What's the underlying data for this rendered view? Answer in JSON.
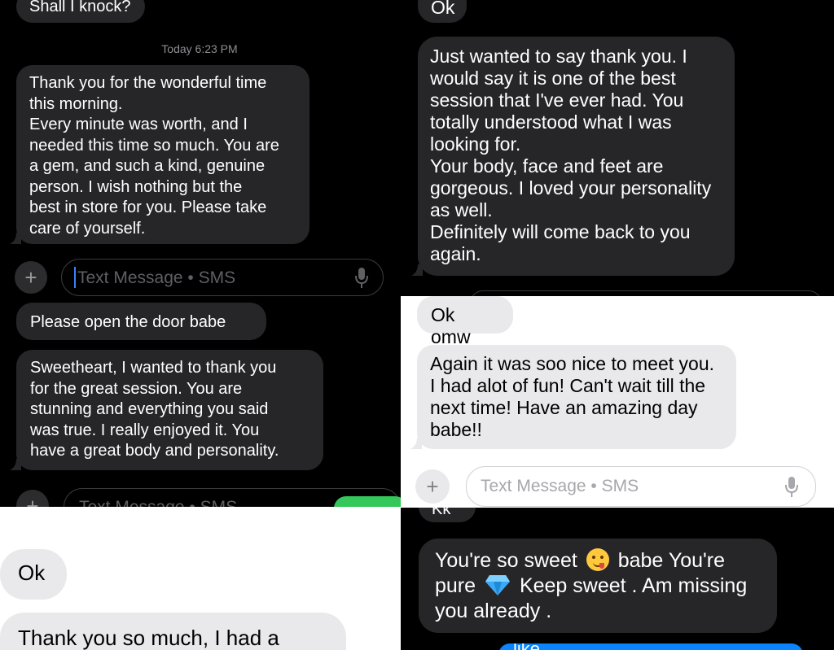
{
  "panel_top_left": {
    "messages": [
      "Shall I knock?",
      "Thank you for the wonderful time\nthis morning.\nEvery minute was worth, and I\nneeded this time so much. You are\na gem, and such a kind, genuine\nperson. I wish nothing but the\nbest in store for you. Please take\ncare of yourself."
    ],
    "timestamp_day": "Today",
    "timestamp_time": "6:23 PM",
    "input_placeholder": "Text Message • SMS"
  },
  "panel_mid_left": {
    "messages": [
      "Please open the door babe",
      "Sweetheart, I wanted to thank you\nfor the great session. You are\nstunning and everything you said\nwas true. I really enjoyed it. You\nhave a great body and personality."
    ],
    "input_placeholder": "Text Message • SMS"
  },
  "panel_bottom_left": {
    "messages": [
      "Ok",
      "Thank you so much, I had a"
    ]
  },
  "panel_top_right": {
    "messages": [
      "Ok",
      "Just wanted to say thank you. I\nwould say it is one of the best\nsession that I've ever had. You\ntotally understood what I was\nlooking for.\nYour body, face and feet are\ngorgeous. I loved your personality\nas well.\nDefinitely will come back to you\nagain."
    ]
  },
  "panel_mid_right": {
    "messages": [
      "Ok omw",
      "Again it was soo nice to meet you.\nI had alot of fun! Can't wait till the\nnext time! Have an amazing day\nbabe!!"
    ],
    "input_placeholder": "Text Message • SMS"
  },
  "panel_bottom_right": {
    "messages": [
      "Kk",
      "You're so sweet",
      "babe You're",
      "pure",
      "Keep sweet . Am missing",
      "you already .",
      "like."
    ],
    "emoji": [
      "smiling-face-emoji",
      "gem-emoji"
    ]
  },
  "colors": {
    "dark_bubble": "#262628",
    "light_bubble": "#e9e9eb",
    "sent_green": "#34c759",
    "sent_blue": "#0a84ff",
    "caret": "#3b82f6"
  }
}
